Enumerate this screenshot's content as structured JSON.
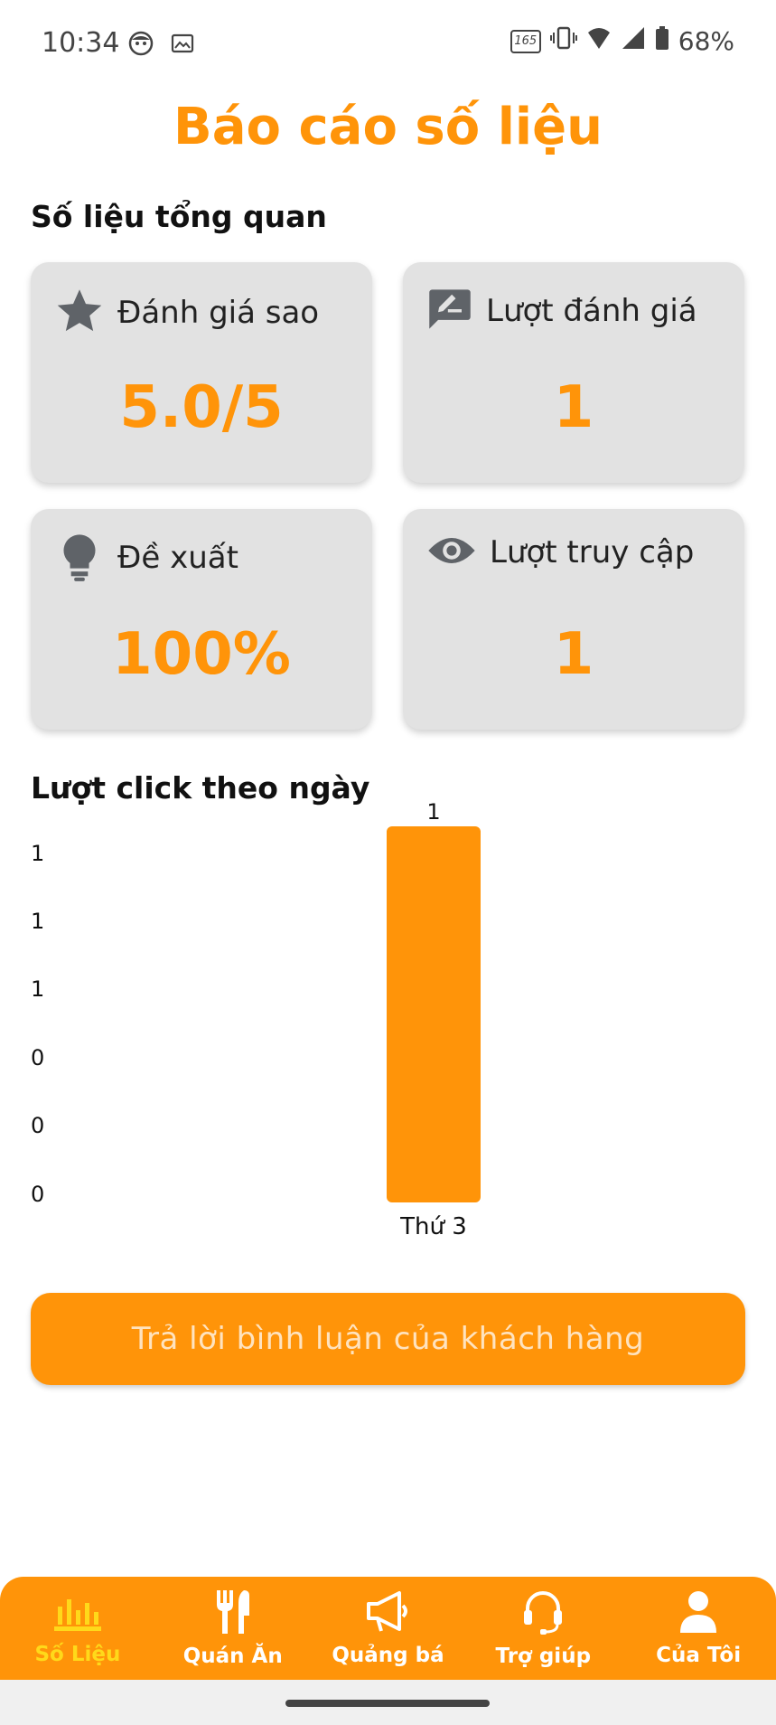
{
  "status_bar": {
    "time": "10:34",
    "battery": "68%",
    "refresh_rate": "165"
  },
  "page": {
    "title": "Báo cáo số liệu",
    "overview_title": "Số liệu tổng quan",
    "chart_title": "Lượt click theo ngày"
  },
  "cards": [
    {
      "icon": "star-icon",
      "label": "Đánh giá sao",
      "value": "5.0/5"
    },
    {
      "icon": "rate-review-icon",
      "label": "Lượt đánh giá",
      "value": "1"
    },
    {
      "icon": "lightbulb-icon",
      "label": "Đề xuất",
      "value": "100%"
    },
    {
      "icon": "eye-icon",
      "label": "Lượt truy cập",
      "value": "1"
    }
  ],
  "chart_data": {
    "type": "bar",
    "categories": [
      "Thứ 3"
    ],
    "values": [
      1
    ],
    "data_labels": [
      "1"
    ],
    "y_tick_labels": [
      "1",
      "1",
      "1",
      "0",
      "0",
      "0"
    ],
    "ylim": [
      0,
      1
    ],
    "color": "#FF9409",
    "grid": false
  },
  "cta": {
    "label": "Trả lời bình luận của khách hàng"
  },
  "tabs": [
    {
      "icon": "bar-chart-icon",
      "label": "Số Liệu",
      "active": true
    },
    {
      "icon": "restaurant-icon",
      "label": "Quán Ăn",
      "active": false
    },
    {
      "icon": "megaphone-icon",
      "label": "Quảng bá",
      "active": false
    },
    {
      "icon": "headset-icon",
      "label": "Trợ giúp",
      "active": false
    },
    {
      "icon": "person-icon",
      "label": "Của Tôi",
      "active": false
    }
  ],
  "colors": {
    "accent": "#FF9409",
    "active_tab": "#FFD91A",
    "card_bg": "#E2E2E2"
  }
}
